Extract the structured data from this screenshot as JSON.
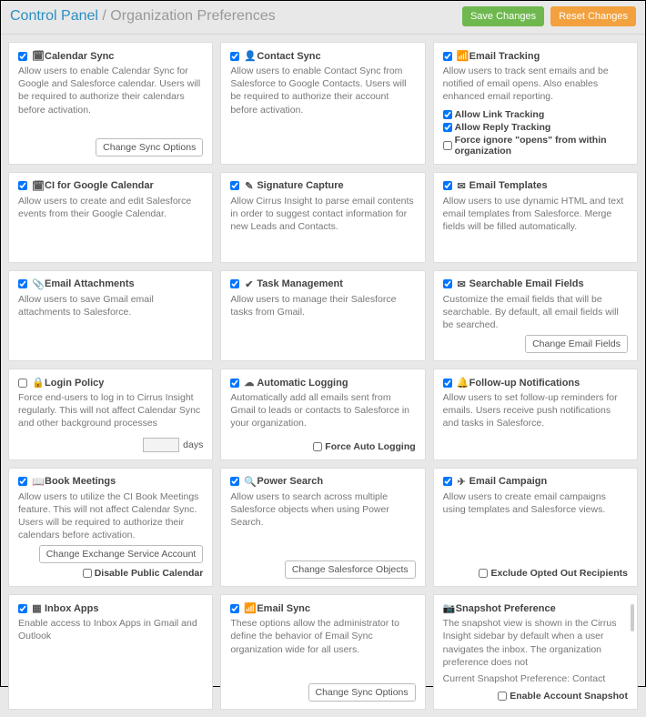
{
  "header": {
    "breadcrumb_root": "Control Panel",
    "breadcrumb_sep": " / ",
    "breadcrumb_current": "Organization Preferences",
    "save_label": "Save Changes",
    "reset_label": "Reset Changes"
  },
  "cards": {
    "calendar_sync": {
      "title": "Calendar Sync",
      "desc": "Allow users to enable Calendar Sync for Google and Salesforce calendar. Users will be required to authorize their calendars before activation.",
      "action": "Change Sync Options"
    },
    "contact_sync": {
      "title": "Contact Sync",
      "desc": "Allow users to enable Contact Sync from Salesforce to Google Contacts. Users will be required to authorize their account before activation."
    },
    "email_tracking": {
      "title": "Email Tracking",
      "desc": "Allow users to track sent emails and be notified of email opens. Also enables enhanced email reporting.",
      "sub1": "Allow Link Tracking",
      "sub2": "Allow Reply Tracking",
      "sub3": "Force ignore \"opens\" from within organization"
    },
    "ci_google": {
      "title": "CI for Google Calendar",
      "desc": "Allow users to create and edit Salesforce events from their Google Calendar."
    },
    "signature_capture": {
      "title": "Signature Capture",
      "desc": "Allow Cirrus Insight to parse email contents in order to suggest contact information for new Leads and Contacts."
    },
    "email_templates": {
      "title": "Email Templates",
      "desc": "Allow users to use dynamic HTML and text email templates from Salesforce. Merge fields will be filled automatically."
    },
    "email_attachments": {
      "title": "Email Attachments",
      "desc": "Allow users to save Gmail email attachments to Salesforce."
    },
    "task_management": {
      "title": "Task Management",
      "desc": "Allow users to manage their Salesforce tasks from Gmail."
    },
    "searchable_email": {
      "title": "Searchable Email Fields",
      "desc": "Customize the email fields that will be searchable. By default, all email fields will be searched.",
      "action": "Change Email Fields"
    },
    "login_policy": {
      "title": "Login Policy",
      "desc": "Force end-users to log in to Cirrus Insight regularly. This will not affect Calendar Sync and other background processes",
      "days_label": "days",
      "days_value": ""
    },
    "auto_logging": {
      "title": "Automatic Logging",
      "desc": "Automatically add all emails sent from Gmail to leads or contacts to Salesforce in your organization.",
      "sub1": "Force Auto Logging"
    },
    "followup": {
      "title": "Follow-up Notifications",
      "desc": "Allow users to set follow-up reminders for emails. Users receive push notifications and tasks in Salesforce."
    },
    "book_meetings": {
      "title": "Book Meetings",
      "desc": "Allow users to utilize the CI Book Meetings feature. This will not affect Calendar Sync. Users will be required to authorize their calendars before activation.",
      "action1": "Change Exchange Service Account",
      "sub1": "Disable Public Calendar"
    },
    "power_search": {
      "title": "Power Search",
      "desc": "Allow users to search across multiple Salesforce objects when using Power Search.",
      "action": "Change Salesforce Objects"
    },
    "email_campaign": {
      "title": "Email Campaign",
      "desc": "Allow users to create email campaigns using templates and Salesforce views.",
      "sub1": "Exclude Opted Out Recipients"
    },
    "inbox_apps": {
      "title": "Inbox Apps",
      "desc": "Enable access to Inbox Apps in Gmail and Outlook"
    },
    "email_sync": {
      "title": "Email Sync",
      "desc": "These options allow the administrator to define the behavior of Email Sync organization wide for all users.",
      "action": "Change Sync Options"
    },
    "snapshot": {
      "title": "Snapshot Preference",
      "desc": "The snapshot view is shown in the Cirrus Insight sidebar by default when a user navigates the inbox. The organization preference does not",
      "current_label": "Current Snapshot Preference: Contact",
      "sub1": "Enable Account Snapshot"
    }
  }
}
